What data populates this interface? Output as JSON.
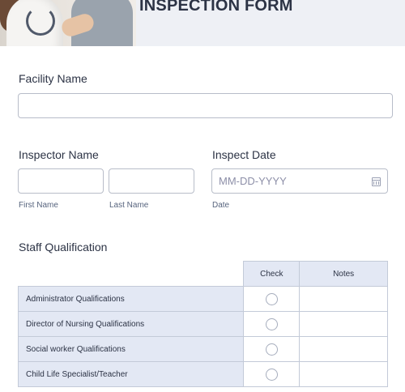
{
  "header": {
    "title": "INSPECTION FORM"
  },
  "facility": {
    "label": "Facility Name",
    "value": ""
  },
  "inspector": {
    "label": "Inspector Name",
    "first_value": "",
    "first_sublabel": "First Name",
    "last_value": "",
    "last_sublabel": "Last Name"
  },
  "inspect_date": {
    "label": "Inspect Date",
    "placeholder": "MM-DD-YYYY",
    "sublabel": "Date"
  },
  "staff": {
    "label": "Staff Qualification",
    "columns": [
      "Check",
      "Notes"
    ],
    "rows": [
      "Administrator Qualifications",
      "Director of Nursing Qualifications",
      "Social worker Qualifications",
      "Child Life Specialist/Teacher"
    ]
  }
}
